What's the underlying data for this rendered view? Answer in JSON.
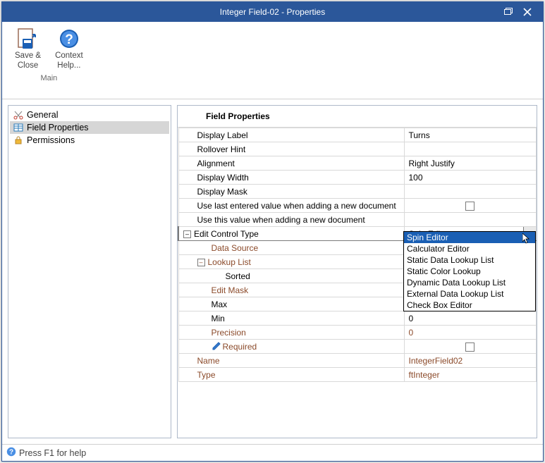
{
  "window": {
    "title": "Integer Field-02 - Properties"
  },
  "ribbon": {
    "group_main": "Main",
    "save_close_l1": "Save &",
    "save_close_l2": "Close",
    "help_l1": "Context",
    "help_l2": "Help..."
  },
  "nav": {
    "general": "General",
    "field_props": "Field Properties",
    "permissions": "Permissions"
  },
  "section_title": "Field Properties",
  "rows": {
    "display_label": {
      "label": "Display Label",
      "value": "Turns"
    },
    "rollover_hint": {
      "label": "Rollover Hint",
      "value": ""
    },
    "alignment": {
      "label": "Alignment",
      "value": "Right Justify"
    },
    "display_width": {
      "label": "Display Width",
      "value": "100"
    },
    "display_mask": {
      "label": "Display Mask",
      "value": ""
    },
    "use_last": {
      "label": "Use last entered value when adding a new document"
    },
    "use_this": {
      "label": "Use this value when adding a new document",
      "value": ""
    },
    "edit_control": {
      "label": "Edit Control Type",
      "value": "Spin Editor"
    },
    "data_source": {
      "label": "Data Source",
      "value": ""
    },
    "lookup_list": {
      "label": "Lookup List",
      "value": ""
    },
    "sorted": {
      "label": "Sorted",
      "value": ""
    },
    "edit_mask": {
      "label": "Edit Mask",
      "value": ""
    },
    "max": {
      "label": "Max",
      "value": ""
    },
    "min": {
      "label": "Min",
      "value": "0"
    },
    "precision": {
      "label": "Precision",
      "value": "0"
    },
    "required": {
      "label": "Required"
    },
    "name": {
      "label": "Name",
      "value": "IntegerField02"
    },
    "type": {
      "label": "Type",
      "value": "ftInteger"
    }
  },
  "dropdown_options": [
    "Spin Editor",
    "Calculator Editor",
    "Static Data Lookup List",
    "Static Color Lookup",
    "Dynamic Data Lookup List",
    "External Data Lookup List",
    "Check Box Editor"
  ],
  "statusbar": {
    "text": "Press F1 for help"
  },
  "icons": {
    "scissors": "scissors-icon",
    "grid": "grid-icon",
    "lock": "lock-icon",
    "help": "help-icon"
  }
}
